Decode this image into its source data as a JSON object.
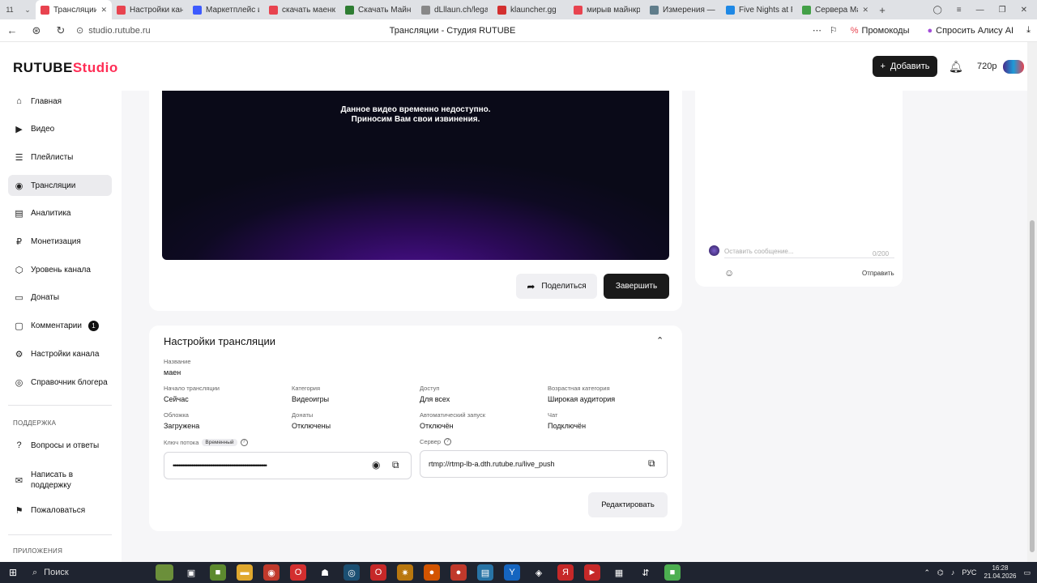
{
  "browser": {
    "tab_count": "11",
    "tabs": [
      {
        "title": "Трансляции",
        "color": "#e8434f",
        "active": true
      },
      {
        "title": "Настройки канала",
        "color": "#e8434f",
        "active": false
      },
      {
        "title": "Маркетплейс и",
        "color": "#3d5afe",
        "active": false
      },
      {
        "title": "скачать маенкр",
        "color": "#e8434f",
        "active": false
      },
      {
        "title": "Скачать Майнкр",
        "color": "#2e7d32",
        "active": false
      },
      {
        "title": "dLllaun.ch/legac",
        "color": "#888888",
        "active": false
      },
      {
        "title": "klauncher.gg",
        "color": "#d32f2f",
        "active": false
      },
      {
        "title": "мирыв майнкр",
        "color": "#e8434f",
        "active": false
      },
      {
        "title": "Измерения — F",
        "color": "#607d8b",
        "active": false
      },
      {
        "title": "Five Nights at F",
        "color": "#1e88e5",
        "active": false
      },
      {
        "title": "Сервера Ma",
        "color": "#43a047",
        "active": false
      }
    ],
    "url": "studio.rutube.ru",
    "page_title": "Трансляции - Студия RUTUBE",
    "promo_label": "Промокоды",
    "alice_label": "Спросить Алису AI"
  },
  "header": {
    "logo_main": "RUTUBE",
    "logo_studio": "Studio",
    "add_label": "Добавить",
    "quality": "720p"
  },
  "sidebar": {
    "items": [
      {
        "label": "Главная",
        "icon": "home-icon",
        "glyph": "⌂"
      },
      {
        "label": "Видео",
        "icon": "video-icon",
        "glyph": "▶"
      },
      {
        "label": "Плейлисты",
        "icon": "playlist-icon",
        "glyph": "☰"
      },
      {
        "label": "Трансляции",
        "icon": "broadcast-icon",
        "glyph": "◉",
        "active": true
      },
      {
        "label": "Аналитика",
        "icon": "analytics-icon",
        "glyph": "▤"
      },
      {
        "label": "Монетизация",
        "icon": "ruble-icon",
        "glyph": "₽"
      },
      {
        "label": "Уровень канала",
        "icon": "level-icon",
        "glyph": "⬡"
      },
      {
        "label": "Донаты",
        "icon": "donate-icon",
        "glyph": "▭"
      },
      {
        "label": "Комментарии",
        "icon": "comments-icon",
        "glyph": "▢",
        "badge": "1"
      },
      {
        "label": "Настройки канала",
        "icon": "gear-icon",
        "glyph": "⚙"
      },
      {
        "label": "Справочник блогера",
        "icon": "guide-icon",
        "glyph": "◎"
      }
    ],
    "support_section": "ПОДДЕРЖКА",
    "support_items": [
      {
        "label": "Вопросы и ответы",
        "icon": "faq-icon",
        "glyph": "?"
      },
      {
        "label": "Написать в поддержку",
        "icon": "mail-icon",
        "glyph": "✉"
      },
      {
        "label": "Пожаловаться",
        "icon": "flag-icon",
        "glyph": "⚑"
      }
    ],
    "apps_section": "ПРИЛОЖЕНИЯ"
  },
  "player": {
    "message_line1": "Данное видео временно недоступно.",
    "message_line2": "Приносим Вам свои извинения.",
    "share_label": "Поделиться",
    "end_label": "Завершить"
  },
  "chat": {
    "placeholder": "Оставить сообщение...",
    "counter": "0/200",
    "send_label": "Отправить"
  },
  "settings": {
    "title": "Настройки трансляции",
    "name_label": "Название",
    "name_value": "маен",
    "fields": [
      {
        "label": "Начало трансляции",
        "value": "Сейчас"
      },
      {
        "label": "Категория",
        "value": "Видеоигры"
      },
      {
        "label": "Доступ",
        "value": "Для всех"
      },
      {
        "label": "Возрастная категория",
        "value": "Широкая аудитория"
      },
      {
        "label": "Обложка",
        "value": "Загружена"
      },
      {
        "label": "Донаты",
        "value": "Отключены"
      },
      {
        "label": "Автоматический запуск",
        "value": "Отключён"
      },
      {
        "label": "Чат",
        "value": "Подключён"
      }
    ],
    "key_label": "Ключ потока",
    "key_tag": "Временный",
    "key_masked": "••••••••••••••••••••••••••••••••••••••••••••••••••••••••••••••••••",
    "server_label": "Сервер",
    "server_url": "rtmp://rtmp-lb-a.dth.rutube.ru/live_push",
    "edit_label": "Редактировать"
  },
  "taskbar": {
    "search_label": "Поиск",
    "lang": "РУС",
    "time": "16:28",
    "date": "21.04.2026"
  }
}
